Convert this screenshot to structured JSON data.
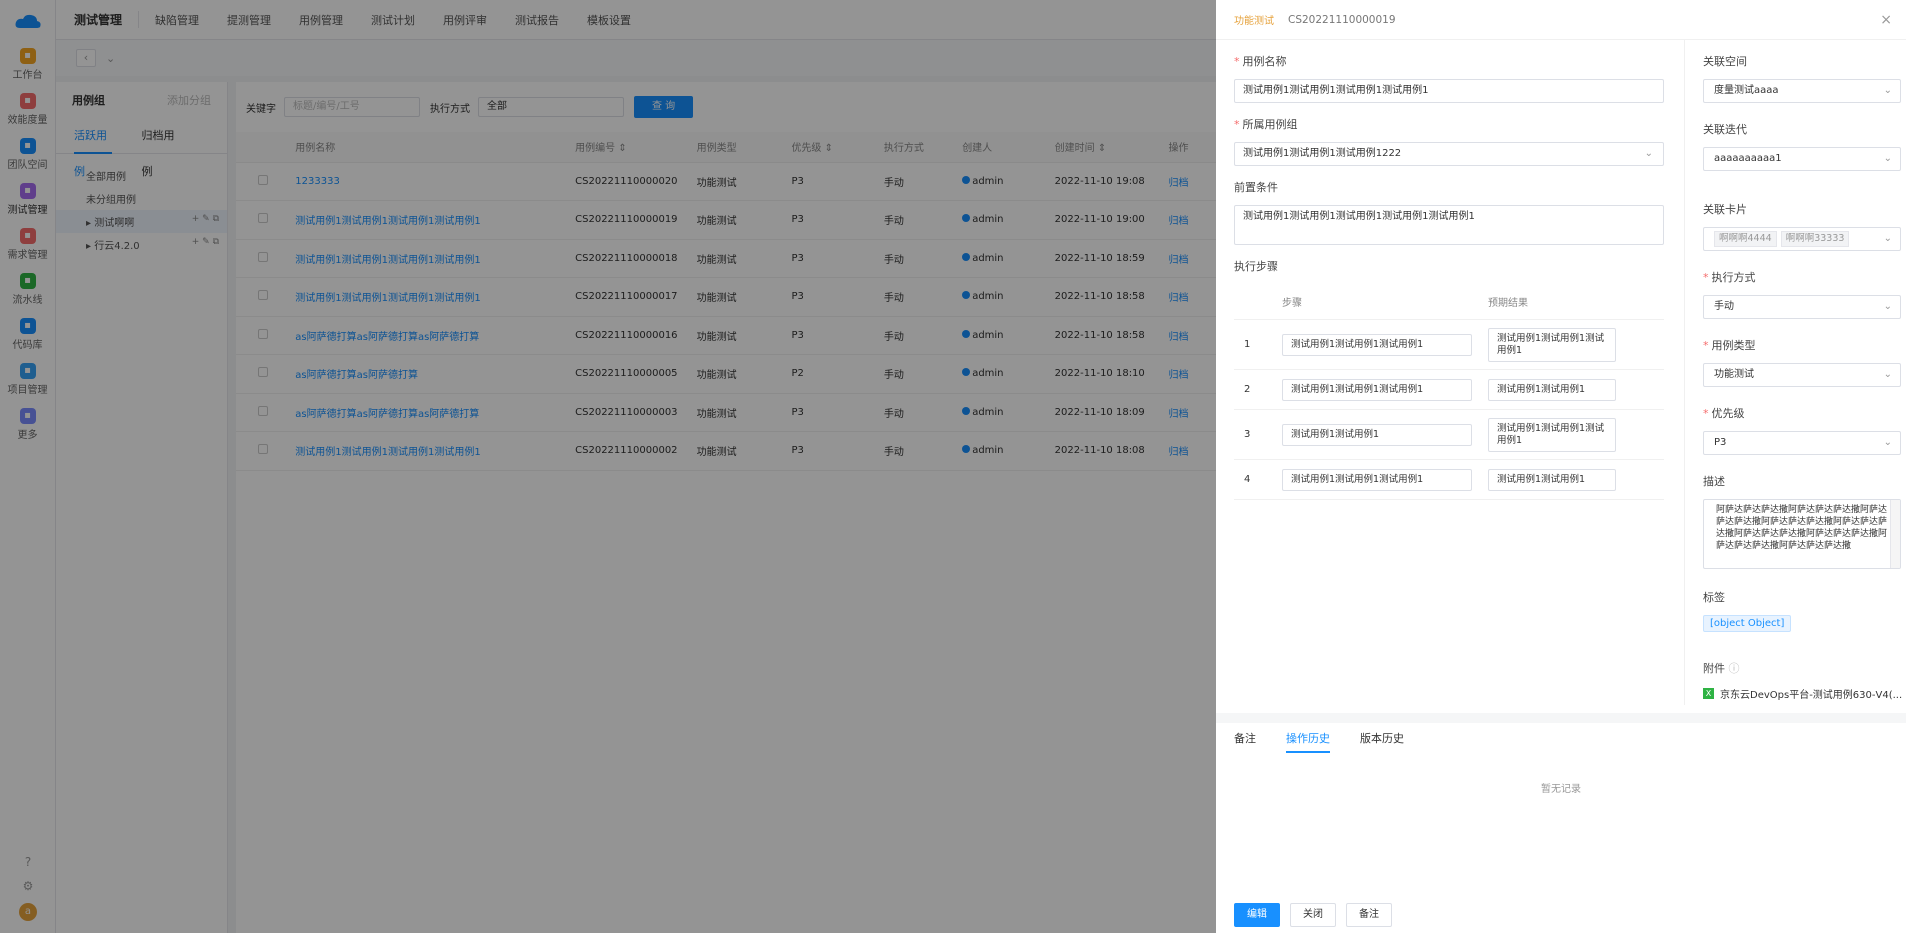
{
  "leftnav": {
    "items": [
      {
        "label": "工作台",
        "icon": "grid-icon",
        "color": "#f5a623"
      },
      {
        "label": "效能度量",
        "icon": "chart-icon",
        "color": "#f56c6c"
      },
      {
        "label": "团队空间",
        "icon": "team-icon",
        "color": "#1890ff"
      },
      {
        "label": "测试管理",
        "icon": "test-icon",
        "color": "#a66cf0"
      },
      {
        "label": "需求管理",
        "icon": "requirement-icon",
        "color": "#f56c6c"
      },
      {
        "label": "流水线",
        "icon": "pipeline-icon",
        "color": "#2fb344"
      },
      {
        "label": "代码库",
        "icon": "code-icon",
        "color": "#1890ff"
      },
      {
        "label": "项目管理",
        "icon": "project-icon",
        "color": "#36a3f7"
      },
      {
        "label": "更多",
        "icon": "more-icon",
        "color": "#7b8cff"
      }
    ],
    "help": "?",
    "settings": "⚙",
    "avatar": "a"
  },
  "topnav": {
    "title": "测试管理",
    "tabs": [
      "缺陷管理",
      "提测管理",
      "用例管理",
      "测试计划",
      "用例评审",
      "测试报告",
      "模板设置"
    ]
  },
  "groups": {
    "title": "用例组",
    "add": "添加分组",
    "tabs": [
      "活跃用例",
      "归档用例"
    ],
    "tree": [
      "全部用例",
      "未分组用例",
      "测试啊啊",
      "行云4.2.0"
    ]
  },
  "filter": {
    "keyword_label": "关键字",
    "keyword_placeholder": "标题/编号/工号",
    "exec_label": "执行方式",
    "exec_value": "全部",
    "query": "查 询"
  },
  "table": {
    "headers": [
      "用例名称",
      "用例编号 ⇕",
      "用例类型",
      "优先级 ⇕",
      "执行方式",
      "创建人",
      "创建时间 ⇕",
      "操作"
    ],
    "rows": [
      {
        "name": "1233333",
        "code": "CS20221110000020",
        "type": "功能测试",
        "pri": "P3",
        "exec": "手动",
        "creator": "admin",
        "time": "2022-11-10 19:08",
        "op": "归档"
      },
      {
        "name": "测试用例1测试用例1测试用例1测试用例1",
        "code": "CS20221110000019",
        "type": "功能测试",
        "pri": "P3",
        "exec": "手动",
        "creator": "admin",
        "time": "2022-11-10 19:00",
        "op": "归档"
      },
      {
        "name": "测试用例1测试用例1测试用例1测试用例1",
        "code": "CS20221110000018",
        "type": "功能测试",
        "pri": "P3",
        "exec": "手动",
        "creator": "admin",
        "time": "2022-11-10 18:59",
        "op": "归档"
      },
      {
        "name": "测试用例1测试用例1测试用例1测试用例1",
        "code": "CS20221110000017",
        "type": "功能测试",
        "pri": "P3",
        "exec": "手动",
        "creator": "admin",
        "time": "2022-11-10 18:58",
        "op": "归档"
      },
      {
        "name": "as阿萨德打算as阿萨德打算as阿萨德打算",
        "code": "CS20221110000016",
        "type": "功能测试",
        "pri": "P3",
        "exec": "手动",
        "creator": "admin",
        "time": "2022-11-10 18:58",
        "op": "归档"
      },
      {
        "name": "as阿萨德打算as阿萨德打算",
        "code": "CS20221110000005",
        "type": "功能测试",
        "pri": "P2",
        "exec": "手动",
        "creator": "admin",
        "time": "2022-11-10 18:10",
        "op": "归档"
      },
      {
        "name": "as阿萨德打算as阿萨德打算as阿萨德打算",
        "code": "CS20221110000003",
        "type": "功能测试",
        "pri": "P3",
        "exec": "手动",
        "creator": "admin",
        "time": "2022-11-10 18:09",
        "op": "归档"
      },
      {
        "name": "测试用例1测试用例1测试用例1测试用例1",
        "code": "CS20221110000002",
        "type": "功能测试",
        "pri": "P3",
        "exec": "手动",
        "creator": "admin",
        "time": "2022-11-10 18:08",
        "op": "归档"
      }
    ]
  },
  "drawer": {
    "type": "功能测试",
    "code": "CS20221110000019",
    "close": "×",
    "name_label": "用例名称",
    "name_value": "测试用例1测试用例1测试用例1测试用例1",
    "group_label": "所属用例组",
    "group_value": "测试用例1测试用例1测试用例1222",
    "pre_label": "前置条件",
    "pre_value": "测试用例1测试用例1测试用例1测试用例1测试用例1",
    "steps_label": "执行步骤",
    "step_head": "步骤",
    "expect_head": "预期结果",
    "steps": [
      {
        "no": "1",
        "step": "测试用例1测试用例1测试用例1",
        "expect": "测试用例1测试用例1测试用例1"
      },
      {
        "no": "2",
        "step": "测试用例1测试用例1测试用例1",
        "expect": "测试用例1测试用例1"
      },
      {
        "no": "3",
        "step": "测试用例1测试用例1",
        "expect": "测试用例1测试用例1测试用例1"
      },
      {
        "no": "4",
        "step": "测试用例1测试用例1测试用例1",
        "expect": "测试用例1测试用例1"
      }
    ],
    "space_label": "关联空间",
    "space_value": "度量测试aaaa",
    "iter_label": "关联迭代",
    "iter_value": "aaaaaaaaaa1",
    "card_label": "关联卡片",
    "cards": [
      "啊啊啊4444",
      "啊啊啊33333"
    ],
    "exec_label": "执行方式",
    "exec_value": "手动",
    "type_label": "用例类型",
    "type_value": "功能测试",
    "pri_label": "优先级",
    "pri_value": "P3",
    "desc_label": "描述",
    "desc_value": "阿萨达萨达萨达撒阿萨达萨达萨达撒阿萨达萨达萨达撒阿萨达萨达萨达撒阿萨达萨达萨达撒阿萨达萨达萨达撒阿萨达萨达萨达撒阿萨达萨达萨达撒阿萨达萨达萨达撒",
    "tag_label": "标签",
    "tag_value": "[object Object]",
    "attach_label": "附件",
    "attach_value": "京东云DevOps平台-测试用例630-V4(...",
    "bottom_tabs": [
      "备注",
      "操作历史",
      "版本历史"
    ],
    "empty": "暂无记录",
    "buttons": [
      "编辑",
      "关闭",
      "备注"
    ]
  }
}
